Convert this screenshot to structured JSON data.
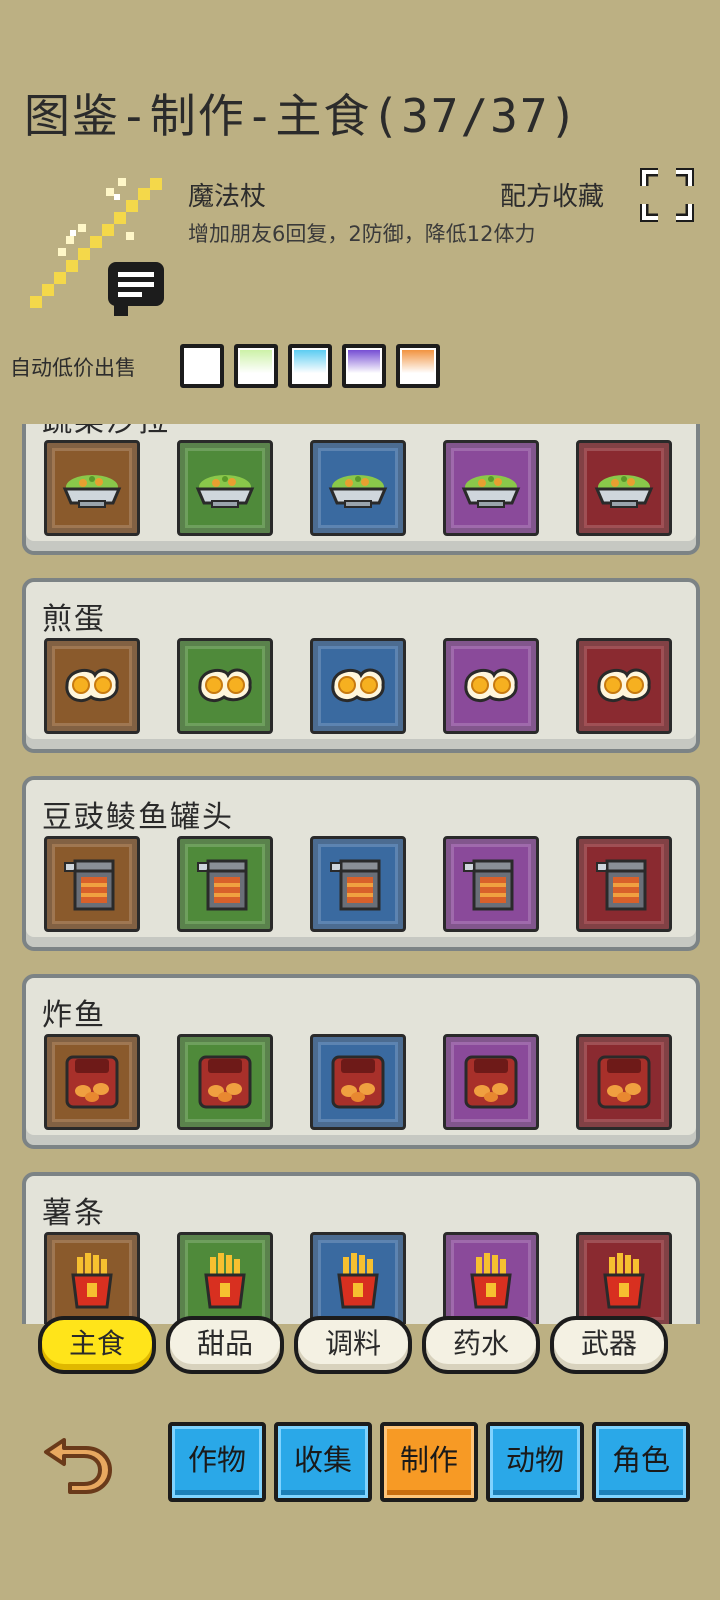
{
  "header": {
    "title": "图鉴-制作-主食(37/37)"
  },
  "selected_item": {
    "name": "魔法杖",
    "description": "增加朋友6回复，2防御，降低12体力",
    "collect_label": "配方收藏",
    "icon": "magic-wand-icon"
  },
  "auto_sell": {
    "label": "自动低价出售",
    "qualities": [
      "#ffffff",
      "#c8f0a0",
      "#4fc8f0",
      "#6a3fd0",
      "#f08a30"
    ]
  },
  "tiers": [
    "#8a5a2c",
    "#4f8a3a",
    "#3a6aa0",
    "#8a4a9a",
    "#8a2a30"
  ],
  "recipes": [
    {
      "name": "蔬菜沙拉",
      "icon": "salad-bowl-icon"
    },
    {
      "name": "煎蛋",
      "icon": "fried-egg-icon"
    },
    {
      "name": "豆豉鲮鱼罐头",
      "icon": "fish-can-icon"
    },
    {
      "name": "炸鱼",
      "icon": "fried-fish-icon"
    },
    {
      "name": "薯条",
      "icon": "fries-icon"
    }
  ],
  "sub_tabs": [
    {
      "label": "主食",
      "active": true
    },
    {
      "label": "甜品",
      "active": false
    },
    {
      "label": "调料",
      "active": false
    },
    {
      "label": "药水",
      "active": false
    },
    {
      "label": "武器",
      "active": false
    }
  ],
  "main_tabs": [
    {
      "label": "作物",
      "active": false
    },
    {
      "label": "收集",
      "active": false
    },
    {
      "label": "制作",
      "active": true
    },
    {
      "label": "动物",
      "active": false
    },
    {
      "label": "角色",
      "active": false
    }
  ]
}
